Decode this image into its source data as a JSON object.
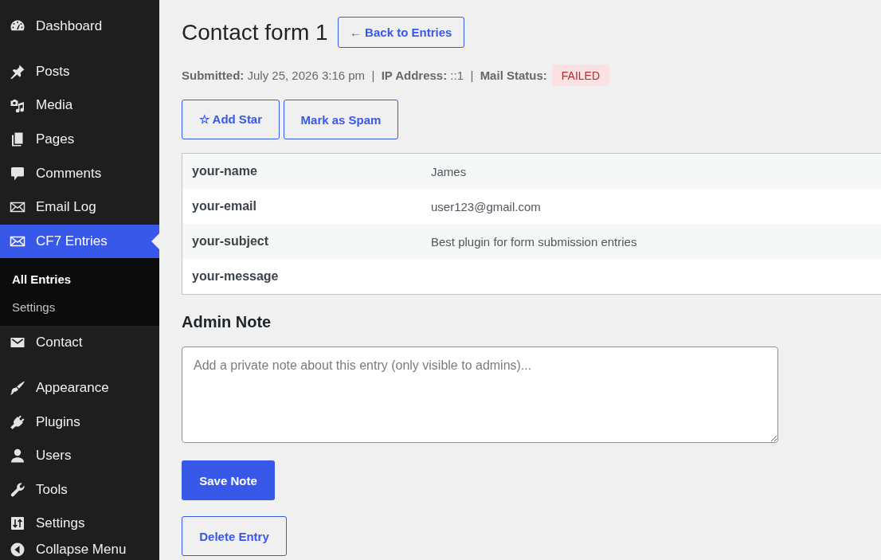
{
  "sidebar": {
    "groups": [
      {
        "items": [
          {
            "label": "Dashboard",
            "selected": false
          }
        ]
      },
      {
        "items": [
          {
            "label": "Posts",
            "selected": false
          },
          {
            "label": "Media",
            "selected": false
          },
          {
            "label": "Pages",
            "selected": false
          },
          {
            "label": "Comments",
            "selected": false
          },
          {
            "label": "Email Log",
            "selected": false
          },
          {
            "label": "CF7 Entries",
            "selected": true,
            "children": [
              {
                "label": "All Entries",
                "selected": true
              },
              {
                "label": "Settings",
                "selected": false
              }
            ]
          },
          {
            "label": "Contact",
            "selected": false
          }
        ]
      },
      {
        "items": [
          {
            "label": "Appearance",
            "selected": false
          },
          {
            "label": "Plugins",
            "selected": false
          },
          {
            "label": "Users",
            "selected": false
          },
          {
            "label": "Tools",
            "selected": false
          },
          {
            "label": "Settings",
            "selected": false
          }
        ]
      }
    ],
    "collapse_button": "Collapse Menu"
  },
  "header": {
    "title": "Contact form 1",
    "back_button": "← Back to Entries"
  },
  "meta": {
    "text": "**Submitted:** July 25, 2026 3:16 pm  |  **IP Address:** ::1  |  **Mail Status:**",
    "mail_status": "FAILED"
  },
  "actions": [
    "☆ Add Star",
    "Mark as Spam"
  ],
  "entry_fields": [
    {
      "field": "your-name",
      "value": "James"
    },
    {
      "field": "your-email",
      "value": "user123@gmail.com"
    },
    {
      "field": "your-subject",
      "value": "Best plugin for form submission entries"
    },
    {
      "field": "your-message"
    }
  ],
  "admin_note": {
    "heading": "Admin Note",
    "placeholder": "Add a private note about this entry (only visible to admins)...",
    "save_button": "Save Note"
  },
  "delete_button": "Delete Entry"
}
